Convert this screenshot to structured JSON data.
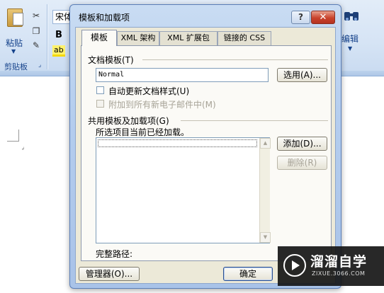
{
  "ribbon": {
    "paste_label": "粘贴",
    "clipboard_group": "剪贴板",
    "font_name": "宋体",
    "bold": "B",
    "highlight": "ab",
    "editing_label": "编辑",
    "find_icon": "binoculars-icon",
    "cut_icon": "scissors-icon",
    "copy_icon": "copy-icon",
    "format_painter_icon": "format-painter-icon"
  },
  "dialog": {
    "title": "模板和加载项",
    "help_glyph": "?",
    "close_glyph": "✕",
    "tabs": [
      {
        "label": "模板",
        "active": true
      },
      {
        "label": "XML 架构",
        "active": false
      },
      {
        "label": "XML 扩展包",
        "active": false
      },
      {
        "label": "链接的 CSS",
        "active": false
      }
    ],
    "document_template": {
      "label": "文档模板(T)",
      "value": "Normal",
      "select_button": "选用(A)..."
    },
    "auto_update": {
      "label": "自动更新文档样式(U)",
      "checked": false,
      "enabled": true
    },
    "attach_email": {
      "label": "附加到所有新电子邮件中(M)",
      "checked": false,
      "enabled": false
    },
    "global_templates": {
      "label": "共用模板及加载项(G)",
      "hint": "所选项目当前已经加载。",
      "items": [],
      "add_button": "添加(D)...",
      "remove_button": "删除(R)",
      "full_path_label": "完整路径:"
    },
    "manager_button": "管理器(O)...",
    "ok_button": "确定"
  },
  "watermark": {
    "title": "溜溜自学",
    "url": "ZIXUE.3066.COM"
  }
}
